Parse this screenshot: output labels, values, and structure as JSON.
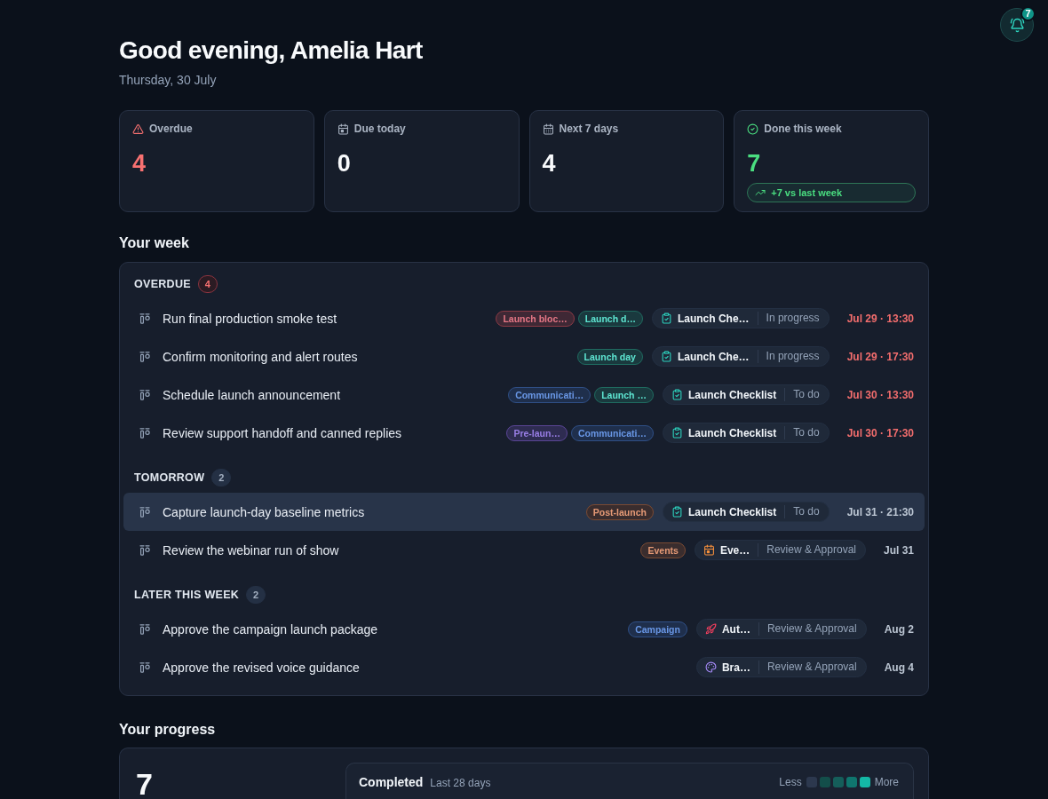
{
  "notifications": {
    "count": "7"
  },
  "greeting": {
    "title": "Good evening, Amelia Hart",
    "date": "Thursday, 30 July"
  },
  "stats": [
    {
      "kind": "overdue",
      "label": "Overdue",
      "value": "4"
    },
    {
      "kind": "today",
      "label": "Due today",
      "value": "0"
    },
    {
      "kind": "week",
      "label": "Next 7 days",
      "value": "4"
    },
    {
      "kind": "done",
      "label": "Done this week",
      "value": "7",
      "trend": "+7 vs last week"
    }
  ],
  "week": {
    "title": "Your week",
    "groups": [
      {
        "kind": "overdue",
        "label": "OVERDUE",
        "count": "4",
        "tasks": [
          {
            "title": "Run final production smoke test",
            "selected": false,
            "tags": [
              {
                "label": "Launch bloc…",
                "color": "#8a3a45"
              },
              {
                "label": "Launch d…",
                "color": "#1f6b60"
              }
            ],
            "project": {
              "kind": "checklist",
              "name": "Launch Che…",
              "status": "In progress"
            },
            "due": "Jul 29 · 13:30"
          },
          {
            "title": "Confirm monitoring and alert routes",
            "selected": false,
            "tags": [
              {
                "label": "Launch day",
                "color": "#1f6b60"
              }
            ],
            "project": {
              "kind": "checklist",
              "name": "Launch Che…",
              "status": "In progress"
            },
            "due": "Jul 29 · 17:30"
          },
          {
            "title": "Schedule launch announcement",
            "selected": false,
            "tags": [
              {
                "label": "Communicati…",
                "color": "#2f4f86"
              },
              {
                "label": "Launch …",
                "color": "#1f6b60"
              }
            ],
            "project": {
              "kind": "checklist",
              "name": "Launch Checklist",
              "status": "To do"
            },
            "due": "Jul 30 · 13:30"
          },
          {
            "title": "Review support handoff and canned replies",
            "selected": false,
            "tags": [
              {
                "label": "Pre-laun…",
                "color": "#5a4596"
              },
              {
                "label": "Communicati…",
                "color": "#2f4f86"
              }
            ],
            "project": {
              "kind": "checklist",
              "name": "Launch Checklist",
              "status": "To do"
            },
            "due": "Jul 30 · 17:30"
          }
        ]
      },
      {
        "kind": "upcoming",
        "label": "TOMORROW",
        "count": "2",
        "tasks": [
          {
            "title": "Capture launch-day baseline metrics",
            "selected": true,
            "tags": [
              {
                "label": "Post-launch",
                "color": "#7a4a33"
              }
            ],
            "project": {
              "kind": "checklist",
              "name": "Launch Checklist",
              "status": "To do"
            },
            "due": "Jul 31 · 21:30"
          },
          {
            "title": "Review the webinar run of show",
            "selected": false,
            "tags": [
              {
                "label": "Events",
                "color": "#7a4a33"
              }
            ],
            "project": {
              "kind": "calendar",
              "name": "Eve…",
              "status": "Review & Approval"
            },
            "due": "Jul 31"
          }
        ]
      },
      {
        "kind": "upcoming",
        "label": "LATER THIS WEEK",
        "count": "2",
        "tasks": [
          {
            "title": "Approve the campaign launch package",
            "selected": false,
            "tags": [
              {
                "label": "Campaign",
                "color": "#2f4f86"
              }
            ],
            "project": {
              "kind": "rocket",
              "name": "Aut…",
              "status": "Review & Approval"
            },
            "due": "Aug 2"
          },
          {
            "title": "Approve the revised voice guidance",
            "selected": false,
            "project": {
              "kind": "palette",
              "name": "Bra…",
              "status": "Review & Approval"
            },
            "due": "Aug 4"
          }
        ]
      }
    ]
  },
  "progress": {
    "title": "Your progress",
    "total": "7",
    "activity": {
      "title": "Completed",
      "period": "Last 28 days",
      "legend_low": "Less",
      "legend_high": "More"
    }
  }
}
